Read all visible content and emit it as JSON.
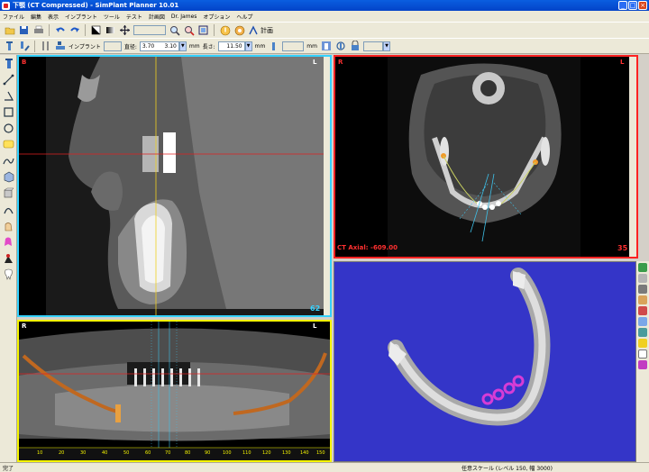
{
  "window": {
    "title": "下顎 (CT Compressed) - SimPlant Planner 10.01",
    "min": "_",
    "max": "□",
    "close": "×"
  },
  "menu": [
    "ファイル",
    "編集",
    "表示",
    "インプラント",
    "ツール",
    "テスト",
    "計画図",
    "Dr. James",
    "オプション",
    "ヘルプ"
  ],
  "toolbar1": {
    "plan_label": "計画"
  },
  "toolbar2": {
    "implant_label": "インプラント",
    "diameter_label": "直径:",
    "diameter_value": "3.70",
    "diameter_value2": "3.10",
    "unit_mm": "mm",
    "length_label": "長さ:",
    "length_value": "11.50"
  },
  "views": {
    "sagittal": {
      "tl": "B",
      "tr": "L",
      "num": "62"
    },
    "axial": {
      "tl": "R",
      "tr": "L",
      "label": "CT Axial: -609.00",
      "num": "35"
    },
    "pano": {
      "tl": "R",
      "tr": "L",
      "ticks": [
        "10",
        "20",
        "30",
        "40",
        "50",
        "60",
        "70",
        "80",
        "90",
        "100",
        "110",
        "120",
        "130",
        "140",
        "150"
      ]
    }
  },
  "status": {
    "left": "完了",
    "right": "任意スケール (レベル 150, 幅 3000)"
  },
  "colors": {
    "sagittal_border": "#35d2ff",
    "axial_border": "#ff2222",
    "pano_border": "#f5f500",
    "threed_bg": "#3435c8"
  }
}
